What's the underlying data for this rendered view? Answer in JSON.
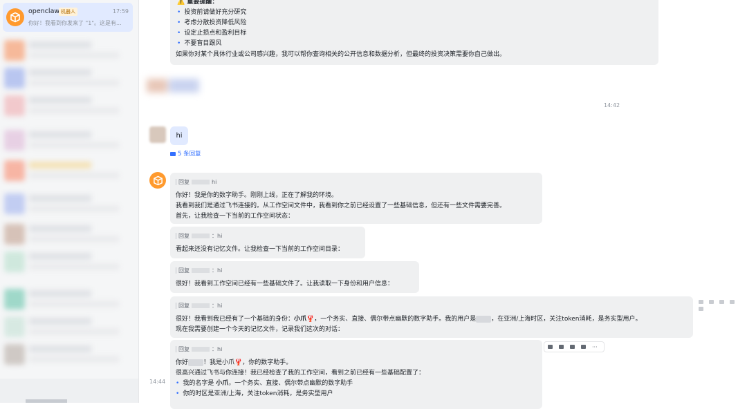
{
  "sidebar": {
    "active_chat": {
      "name": "openclaw",
      "tag": "机器人",
      "time": "17:59",
      "preview": "你好！我看到你发来了 \"1\"。这是有..."
    }
  },
  "messages": {
    "top_bubble": {
      "warning_title": "重要提醒：",
      "tips": [
        "投资前请做好充分研究",
        "考虑分散投资降低风险",
        "设定止损点和盈利目标",
        "不要盲目跟风"
      ],
      "note": "如果你对某个具体行业或公司感兴趣，我可以帮你查询相关的公开信息和数据分析，但最终的投资决策需要你自己做出。"
    },
    "timestamp_1": "14:42",
    "user_message": "hi",
    "replies_link": "5 条回复",
    "reply_prefix": "回复",
    "reply_target": "hi",
    "bot_1": [
      "你好！我是你的数字助手。刚刚上线，正在了解我的环境。",
      "我看到我们是通过飞书连接的。从工作空间文件中，我看到你之前已经设置了一些基础信息，但还有一些文件需要完善。",
      "首先，让我检查一下当前的工作空间状态："
    ],
    "bot_2": "看起来还没有记忆文件。让我检查一下当前的工作空间目录：",
    "bot_3": "很好！我看到工作空间已经有一些基础文件了。让我读取一下身份和用户信息：",
    "bot_4": {
      "line1_a": "很好！我看到我已经有了一个基础的身份：",
      "line1_name": "小爪",
      "line1_b": "，一个务实、直接、偶尔带点幽默的数字助手。我的用户是",
      "line1_c": "，在亚洲/上海时区，关注token消耗，是务实型用户。",
      "line2": "现在我需要创建一个今天的记忆文件，记录我们这次的对话："
    },
    "bot_5": {
      "line1_a": "你好",
      "line1_b": "！我是小爪",
      "line1_c": "，你的数字助手。",
      "line2": "很高兴通过飞书与你连接！我已经检查了我的工作空间，看到之前已经有一些基础配置了：",
      "bullet1_a": "我的名字是 ",
      "bullet1_name": "小爪",
      "bullet1_b": "，一个务实、直接、偶尔带点幽默的数字助手",
      "bullet2": "你的时区是亚洲/上海，关注token消耗，是务实型用户"
    },
    "timestamp_2": "14:44",
    "crab_icon": "🦞",
    "accent_color": "#3370ff"
  }
}
